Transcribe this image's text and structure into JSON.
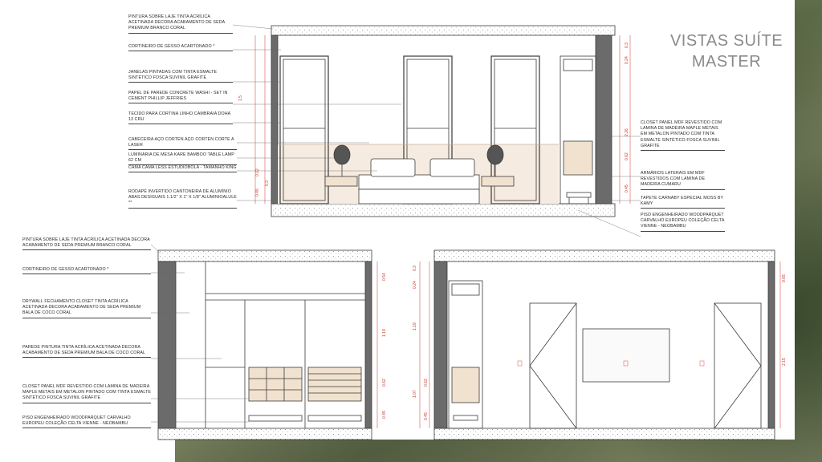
{
  "title": {
    "line1": "VISTAS SUÍTE",
    "line2": "MASTER"
  },
  "elevation_a": {
    "notes_left": [
      "PINTURA SOBRE LAJE TINTA ACRÍLICA ACETINADA DECORA ACABAMENTO DE SEDA PREMIUM BRANCO CORAL",
      "CORTINEIRO DE GESSO ACARTONADO *",
      "JANELAS PINTADAS COM TINTA ESMALTE SINTÉTICO FOSCA SUVINIL GRAFITE",
      "PAPEL DE PAREDE CONCRETE WASHI - SET IN CEMENT PHILLIP JEFFRIES",
      "TECIDO PARA CORTINA LINHO CAMBRAIA DOHA 13 CRU",
      "CABECEIRA AÇO CORTEN AÇO CORTEN CORTE A LASER",
      "LUMINÁRIA DE MESA KARE BAMBOO TABLE LAMP 62 CM",
      "CAMA CAMA LESS ESTUDIOBOLA - TAMANHO KING",
      "RODAPÉ INVERTIDO CANTONEIRA DE ALUMÍNIO ABAS DESIGUAIS 1.1/2\" X 1\" X 1/8\" ALUMINIOALULE **"
    ],
    "notes_right": [
      "CLOSET PANEL MDF REVESTIDO COM LAMINA DE MADEIRA MAPLE METAIS EM METALON PINTADO COM TINTA ESMALTE SINTÉTICO FOSCA SUVINIL GRAFITE",
      "ARMÁRIOS LATERAIS EM MDF REVESTIDOS COM LAMINA DE MADEIRA CUMARU",
      "TAPETE CARNABY ESPECIAL MOSS BY KAMY",
      "PISO ENGENHEIRADO WOODPARQUET CARVALHO EUROPEU COLEÇÃO CELTA VIENNE - NEOBAMBU"
    ],
    "dims_left": [
      "0.12",
      "0.3",
      "0.2",
      "0.23",
      "0.45",
      "1.5"
    ],
    "dims_right": [
      "0.3",
      "0.24",
      "2.26",
      "0.62",
      "0.45"
    ]
  },
  "elevation_b": {
    "notes": [
      "PINTURA SOBRE LAJE TINTA ACRÍLICA ACETINADA DECORA ACABAMENTO DE SEDA PREMIUM BRANCO CORAL",
      "CORTINEIRO DE GESSO ACARTONADO *",
      "DRYWALL FECHAMENTO CLOSET TINTA ACRÍLICA ACETINADA DECORA ACABAMENTO DE SEDA PREMIUM BALA DE COCO CORAL",
      "PAREDE PINTURA TINTA ACRÍLICA ACETINADA DECORA ACABAMENTO DE SEDA PREMIUM BALA DE COCO CORAL",
      "CLOSET PANEL MDF REVESTIDO COM LAMINA DE MADEIRA MAPLE METAIS EM METALON PINTADO COM TINTA ESMALTE SINTÉTICO FOSCA SUVINIL GRAFITE",
      "PISO ENGENHEIRADO WOODPARQUET CARVALHO EUROPEU COLEÇÃO CELTA VIENNE - NEOBAMBU"
    ],
    "dims_right": [
      "0.54",
      "1.19",
      "0.62",
      "0.45"
    ]
  },
  "elevation_c": {
    "dims_left": [
      "0.3",
      "0.24",
      "1.19",
      "0.62",
      "1.07",
      "0.45"
    ],
    "dims_right": [
      "0.65",
      "2.15"
    ]
  },
  "colors": {
    "wall_dark": "#6b6b6b",
    "wood": "#f1e2cf",
    "wallpaper": "#f6ebe0",
    "line": "#3a3a3a",
    "dim_red": "#d9534f",
    "title_gray": "#8a8a8a"
  }
}
